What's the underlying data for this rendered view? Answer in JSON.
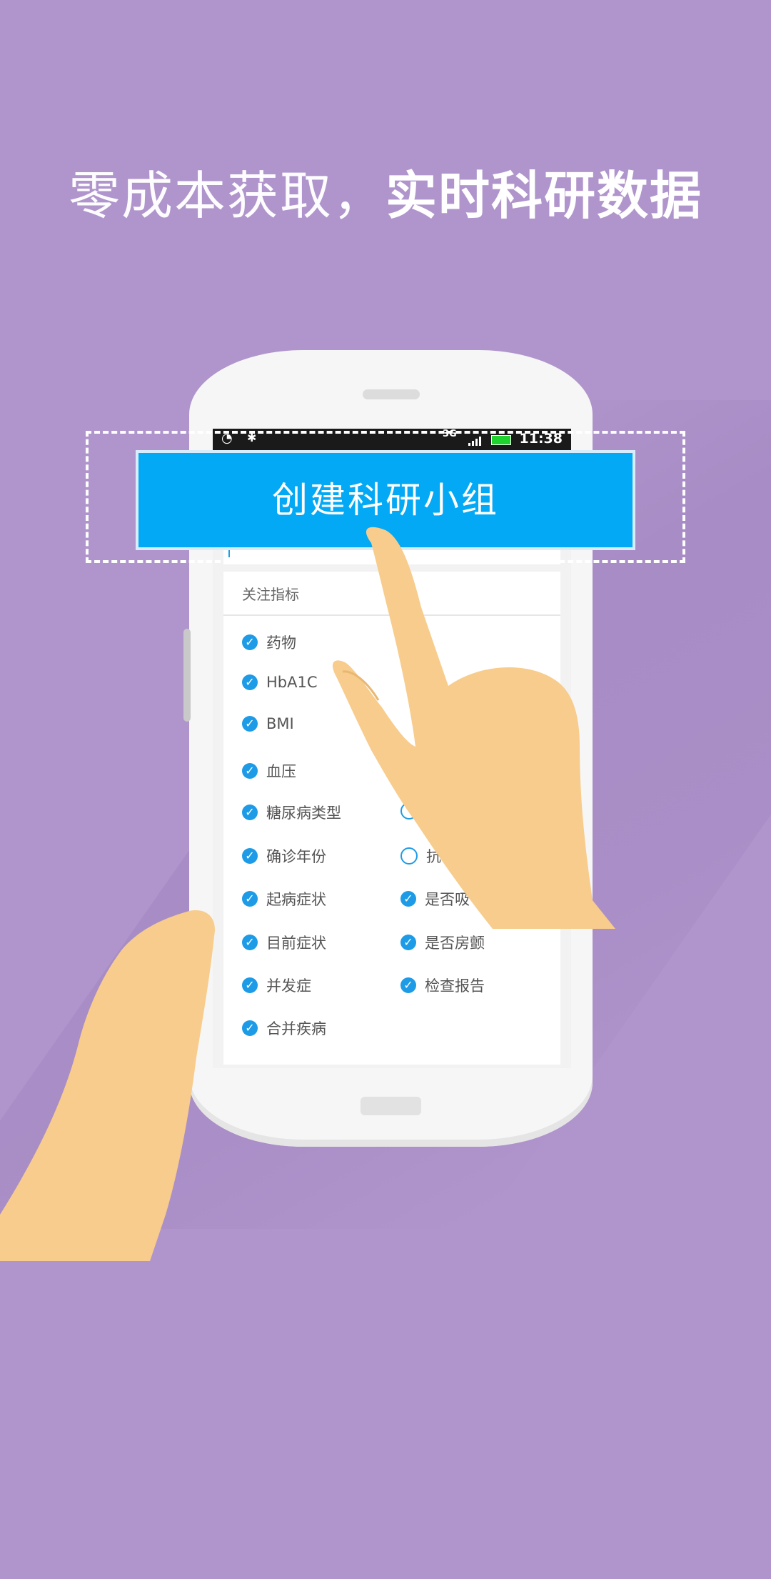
{
  "headline": {
    "light": "零成本获取，",
    "bold": "实时科研数据"
  },
  "statusbar": {
    "network": "3G",
    "time": "11:38"
  },
  "cta": {
    "label": "创建科研小组"
  },
  "card": {
    "title": "关注指标",
    "left_options": [
      {
        "label": "药物",
        "checked": true
      },
      {
        "label": "HbA1C",
        "checked": true
      },
      {
        "label": "BMI",
        "checked": true
      },
      {
        "label": "血压",
        "checked": true
      },
      {
        "label": "糖尿病类型",
        "checked": true
      },
      {
        "label": "确诊年份",
        "checked": true
      },
      {
        "label": "起病症状",
        "checked": true
      },
      {
        "label": "目前症状",
        "checked": true
      },
      {
        "label": "并发症",
        "checked": true
      },
      {
        "label": "合并疾病",
        "checked": true
      }
    ],
    "right_options": [
      {
        "label": "",
        "checked": false
      },
      {
        "label": "抗",
        "checked": false
      },
      {
        "label": "是否吸",
        "checked": true
      },
      {
        "label": "是否房颤",
        "checked": true
      },
      {
        "label": "检查报告",
        "checked": true
      }
    ]
  },
  "icons": {
    "check": "✓",
    "wifi": "wifi-icon",
    "bluetooth": "bluetooth-icon"
  },
  "colors": {
    "background": "#b095cc",
    "accent": "#03a9f4",
    "check": "#1e9be6",
    "skin": "#f7cc8c"
  }
}
